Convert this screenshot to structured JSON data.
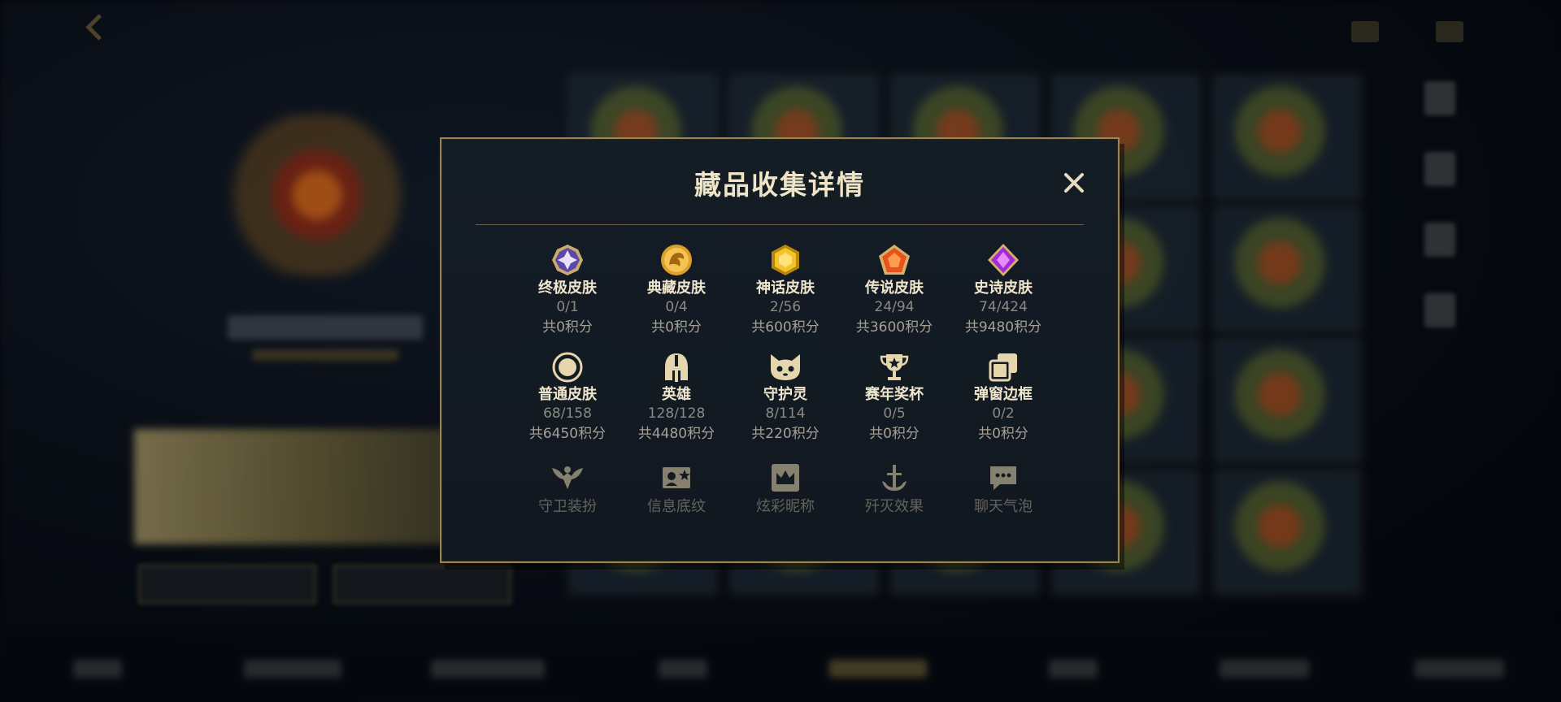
{
  "modal": {
    "title": "藏品收集详情",
    "close_icon": "close-icon"
  },
  "accent_color": "#c9aa6a",
  "collection_items": [
    {
      "label": "终极皮肤",
      "count": "0/1",
      "points": "共0积分",
      "icon": "ultimate-gem-icon"
    },
    {
      "label": "典藏皮肤",
      "count": "0/4",
      "points": "共0积分",
      "icon": "dragon-coin-icon"
    },
    {
      "label": "神话皮肤",
      "count": "2/56",
      "points": "共600积分",
      "icon": "gold-hexagon-gem-icon"
    },
    {
      "label": "传说皮肤",
      "count": "24/94",
      "points": "共3600积分",
      "icon": "orange-pentagon-gem-icon"
    },
    {
      "label": "史诗皮肤",
      "count": "74/424",
      "points": "共9480积分",
      "icon": "purple-diamond-gem-icon"
    },
    {
      "label": "普通皮肤",
      "count": "68/158",
      "points": "共6450积分",
      "icon": "circle-ring-icon"
    },
    {
      "label": "英雄",
      "count": "128/128",
      "points": "共4480积分",
      "icon": "spartan-helmet-icon"
    },
    {
      "label": "守护灵",
      "count": "8/114",
      "points": "共220积分",
      "icon": "cat-spirit-icon"
    },
    {
      "label": "赛年奖杯",
      "count": "0/5",
      "points": "共0积分",
      "icon": "trophy-icon"
    },
    {
      "label": "弹窗边框",
      "count": "0/2",
      "points": "共0积分",
      "icon": "stacked-frames-icon"
    },
    {
      "label": "守卫装扮",
      "icon": "guard-wings-icon"
    },
    {
      "label": "信息底纹",
      "icon": "profile-card-icon"
    },
    {
      "label": "炫彩昵称",
      "icon": "crown-nameplate-icon"
    },
    {
      "label": "歼灭效果",
      "icon": "anchor-sword-icon"
    },
    {
      "label": "聊天气泡",
      "icon": "chat-bubble-icon"
    }
  ]
}
